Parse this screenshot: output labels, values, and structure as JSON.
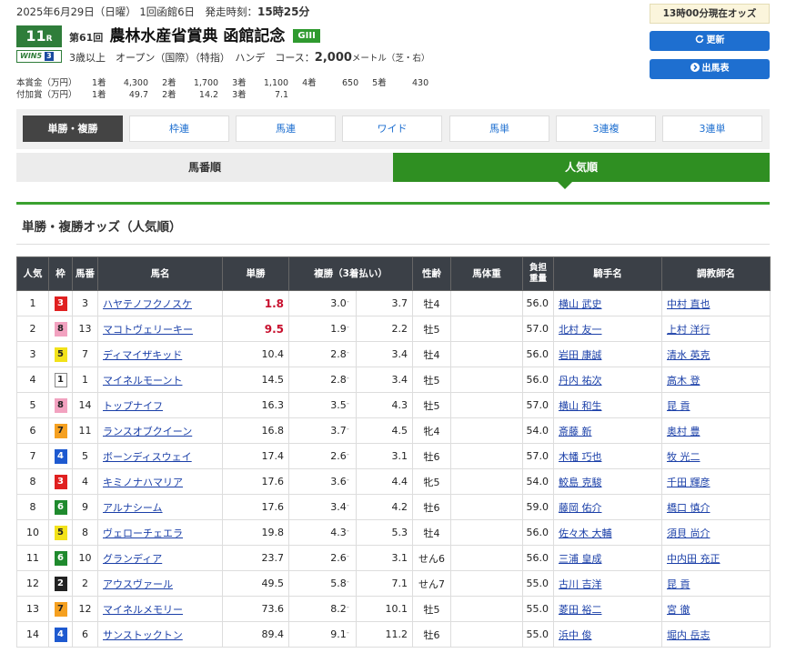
{
  "race": {
    "date_line_prefix": "2025年6月29日（日曜） 1回函館6日　発走時刻：",
    "post_time": "15時25分",
    "race_no": "11",
    "race_no_suffix": "R",
    "win5_label": "WIN5",
    "win5_no": "3",
    "kai": "第61回",
    "name": "農林水産省賞典 函館記念",
    "grade": "GIII",
    "conditions": "3歳以上　オープン（国際）（特指）　ハンデ　コース：",
    "distance": "2,000",
    "distance_unit": "メートル（芝・右）"
  },
  "prize": {
    "rows": [
      {
        "label": "本賞金（万円）",
        "items": [
          [
            "1着",
            "4,300"
          ],
          [
            "2着",
            "1,700"
          ],
          [
            "3着",
            "1,100"
          ],
          [
            "4着",
            "650"
          ],
          [
            "5着",
            "430"
          ]
        ]
      },
      {
        "label": "付加賞（万円）",
        "items": [
          [
            "1着",
            "49.7"
          ],
          [
            "2着",
            "14.2"
          ],
          [
            "3着",
            "7.1"
          ]
        ]
      }
    ]
  },
  "side": {
    "odds_time": "13時00分現在オッズ",
    "refresh": "更新",
    "entry": "出馬表"
  },
  "tabs": [
    "単勝・複勝",
    "枠連",
    "馬連",
    "ワイド",
    "馬単",
    "3連複",
    "3連単"
  ],
  "sort": {
    "left": "馬番順",
    "right": "人気順"
  },
  "section_title": "単勝・複勝オッズ（人気順）",
  "table": {
    "headers": [
      "人気",
      "枠",
      "馬番",
      "馬名",
      "単勝",
      "複勝（3着払い）",
      "性齢",
      "馬体重",
      "負担重量",
      "騎手名",
      "調教師名"
    ],
    "rows": [
      {
        "rank": "1",
        "waku": "3",
        "no": "3",
        "name": "ハヤテノフクノスケ",
        "win": "1.8",
        "plmin": "3.0",
        "plmax": "3.7",
        "sexage": "牡4",
        "weight": "",
        "load": "56.0",
        "jockey": "横山 武史",
        "trainer": "中村 直也"
      },
      {
        "rank": "2",
        "waku": "8",
        "no": "13",
        "name": "マコトヴェリーキー",
        "win": "9.5",
        "plmin": "1.9",
        "plmax": "2.2",
        "sexage": "牡5",
        "weight": "",
        "load": "57.0",
        "jockey": "北村 友一",
        "trainer": "上村 洋行"
      },
      {
        "rank": "3",
        "waku": "5",
        "no": "7",
        "name": "ディマイザキッド",
        "win": "10.4",
        "plmin": "2.8",
        "plmax": "3.4",
        "sexage": "牡4",
        "weight": "",
        "load": "56.0",
        "jockey": "岩田 康誠",
        "trainer": "清水 英克"
      },
      {
        "rank": "4",
        "waku": "1",
        "no": "1",
        "name": "マイネルモーント",
        "win": "14.5",
        "plmin": "2.8",
        "plmax": "3.4",
        "sexage": "牡5",
        "weight": "",
        "load": "56.0",
        "jockey": "丹内 祐次",
        "trainer": "高木 登"
      },
      {
        "rank": "5",
        "waku": "8",
        "no": "14",
        "name": "トップナイフ",
        "win": "16.3",
        "plmin": "3.5",
        "plmax": "4.3",
        "sexage": "牡5",
        "weight": "",
        "load": "57.0",
        "jockey": "横山 和生",
        "trainer": "昆 貢"
      },
      {
        "rank": "6",
        "waku": "7",
        "no": "11",
        "name": "ランスオブクイーン",
        "win": "16.8",
        "plmin": "3.7",
        "plmax": "4.5",
        "sexage": "牝4",
        "weight": "",
        "load": "54.0",
        "jockey": "斎藤 新",
        "trainer": "奥村 豊"
      },
      {
        "rank": "7",
        "waku": "4",
        "no": "5",
        "name": "ボーンディスウェイ",
        "win": "17.4",
        "plmin": "2.6",
        "plmax": "3.1",
        "sexage": "牡6",
        "weight": "",
        "load": "57.0",
        "jockey": "木幡 巧也",
        "trainer": "牧 光二"
      },
      {
        "rank": "8",
        "waku": "3",
        "no": "4",
        "name": "キミノナハマリア",
        "win": "17.6",
        "plmin": "3.6",
        "plmax": "4.4",
        "sexage": "牝5",
        "weight": "",
        "load": "54.0",
        "jockey": "鮫島 克駿",
        "trainer": "千田 輝彦"
      },
      {
        "rank": "8",
        "waku": "6",
        "no": "9",
        "name": "アルナシーム",
        "win": "17.6",
        "plmin": "3.4",
        "plmax": "4.2",
        "sexage": "牡6",
        "weight": "",
        "load": "59.0",
        "jockey": "藤岡 佑介",
        "trainer": "橋口 慎介"
      },
      {
        "rank": "10",
        "waku": "5",
        "no": "8",
        "name": "ヴェローチェエラ",
        "win": "19.8",
        "plmin": "4.3",
        "plmax": "5.3",
        "sexage": "牡4",
        "weight": "",
        "load": "56.0",
        "jockey": "佐々木 大輔",
        "trainer": "須貝 尚介"
      },
      {
        "rank": "11",
        "waku": "6",
        "no": "10",
        "name": "グランディア",
        "win": "23.7",
        "plmin": "2.6",
        "plmax": "3.1",
        "sexage": "せん6",
        "weight": "",
        "load": "56.0",
        "jockey": "三浦 皇成",
        "trainer": "中内田 充正"
      },
      {
        "rank": "12",
        "waku": "2",
        "no": "2",
        "name": "アウスヴァール",
        "win": "49.5",
        "plmin": "5.8",
        "plmax": "7.1",
        "sexage": "せん7",
        "weight": "",
        "load": "55.0",
        "jockey": "古川 吉洋",
        "trainer": "昆 貢"
      },
      {
        "rank": "13",
        "waku": "7",
        "no": "12",
        "name": "マイネルメモリー",
        "win": "73.6",
        "plmin": "8.2",
        "plmax": "10.1",
        "sexage": "牡5",
        "weight": "",
        "load": "55.0",
        "jockey": "菱田 裕二",
        "trainer": "宮 徹"
      },
      {
        "rank": "14",
        "waku": "4",
        "no": "6",
        "name": "サンストックトン",
        "win": "89.4",
        "plmin": "9.1",
        "plmax": "11.2",
        "sexage": "牡6",
        "weight": "",
        "load": "55.0",
        "jockey": "浜中 俊",
        "trainer": "堀内 岳志"
      }
    ]
  },
  "colors": {
    "accent_green": "#2f8f22",
    "button_blue": "#1e6fd0",
    "hot_odds_red": "#c8102e",
    "header_dark": "#3b4047"
  }
}
